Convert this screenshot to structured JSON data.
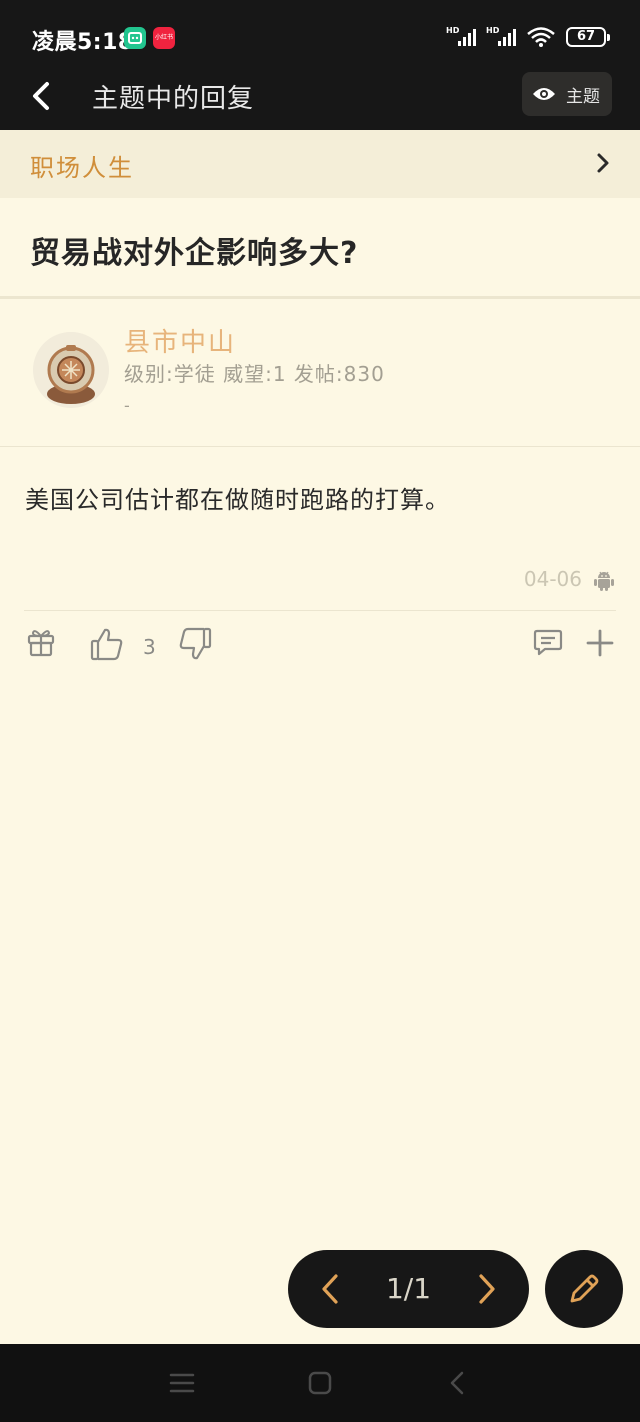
{
  "status_bar": {
    "time": "凌晨5:18",
    "battery": "67",
    "app_badge_text": "小红书"
  },
  "header": {
    "title": "主题中的回复",
    "theme_button": "主题"
  },
  "forum": {
    "name": "职场人生"
  },
  "thread": {
    "title": "贸易战对外企影响多大?"
  },
  "post": {
    "author": "县市中山",
    "author_info": "级别:学徒 威望:1 发帖:830",
    "signature": "-",
    "content": "美国公司估计都在做随时跑路的打算。",
    "date": "04-06",
    "like_count": "3"
  },
  "pager": {
    "label": "1/1"
  },
  "colors": {
    "background": "#fdf8e4",
    "dark_bar": "#171717",
    "accent": "#d08e3a",
    "username": "#e7b47b"
  },
  "icons": {
    "back": "chevron-left-icon",
    "theme": "eye-icon",
    "forum_chevron": "chevron-right-icon",
    "platform": "android-icon",
    "gift": "gift-icon",
    "like": "thumbs-up-icon",
    "dislike": "thumbs-down-icon",
    "comment": "comment-icon",
    "more": "plus-icon",
    "compose": "pencil-icon"
  }
}
